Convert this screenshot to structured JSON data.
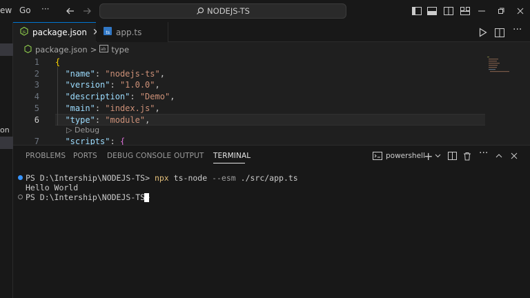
{
  "titlebar": {
    "menu": [
      "ew",
      "Go",
      "···"
    ],
    "search_label": "NODEJS-TS",
    "window_controls": [
      "minimize-icon",
      "restore-icon",
      "close-icon"
    ]
  },
  "left": {
    "partial_label": "on"
  },
  "tabs": [
    {
      "label": "package.json",
      "icon": "node-icon",
      "active": true
    },
    {
      "label": "app.ts",
      "icon": "typescript-icon",
      "active": false
    }
  ],
  "breadcrumb": {
    "file": "package.json",
    "separator": ">",
    "symbol": "type"
  },
  "editor": {
    "lines": [
      {
        "num": "1"
      },
      {
        "num": "2",
        "key": "\"name\"",
        "value": "\"nodejs-ts\""
      },
      {
        "num": "3",
        "key": "\"version\"",
        "value": "\"1.0.0\""
      },
      {
        "num": "4",
        "key": "\"description\"",
        "value": "\"Demo\""
      },
      {
        "num": "5",
        "key": "\"main\"",
        "value": "\"index.js\""
      },
      {
        "num": "6",
        "key": "\"type\"",
        "value": "\"module\""
      },
      {
        "num": "7",
        "key": "\"scripts\""
      }
    ],
    "codelens": "Debug",
    "active_line": 6
  },
  "panel": {
    "tabs": [
      "PROBLEMS",
      "PORTS",
      "DEBUG CONSOLE",
      "OUTPUT",
      "TERMINAL"
    ],
    "active_tab": "TERMINAL",
    "shell": "powershell"
  },
  "terminal": {
    "prompt1": "PS D:\\Intership\\NODEJS-TS>",
    "cmd": "npx",
    "cmd_args1": "ts-node",
    "cmd_flag": "--esm",
    "cmd_args2": "./src/app.ts",
    "output": "Hello World",
    "prompt2": "PS D:\\Intership\\NODEJS-TS>"
  },
  "colors": {
    "accent": "#0078d4",
    "string": "#ce9178",
    "key": "#9cdcfe",
    "bracket": "#ffd700"
  }
}
